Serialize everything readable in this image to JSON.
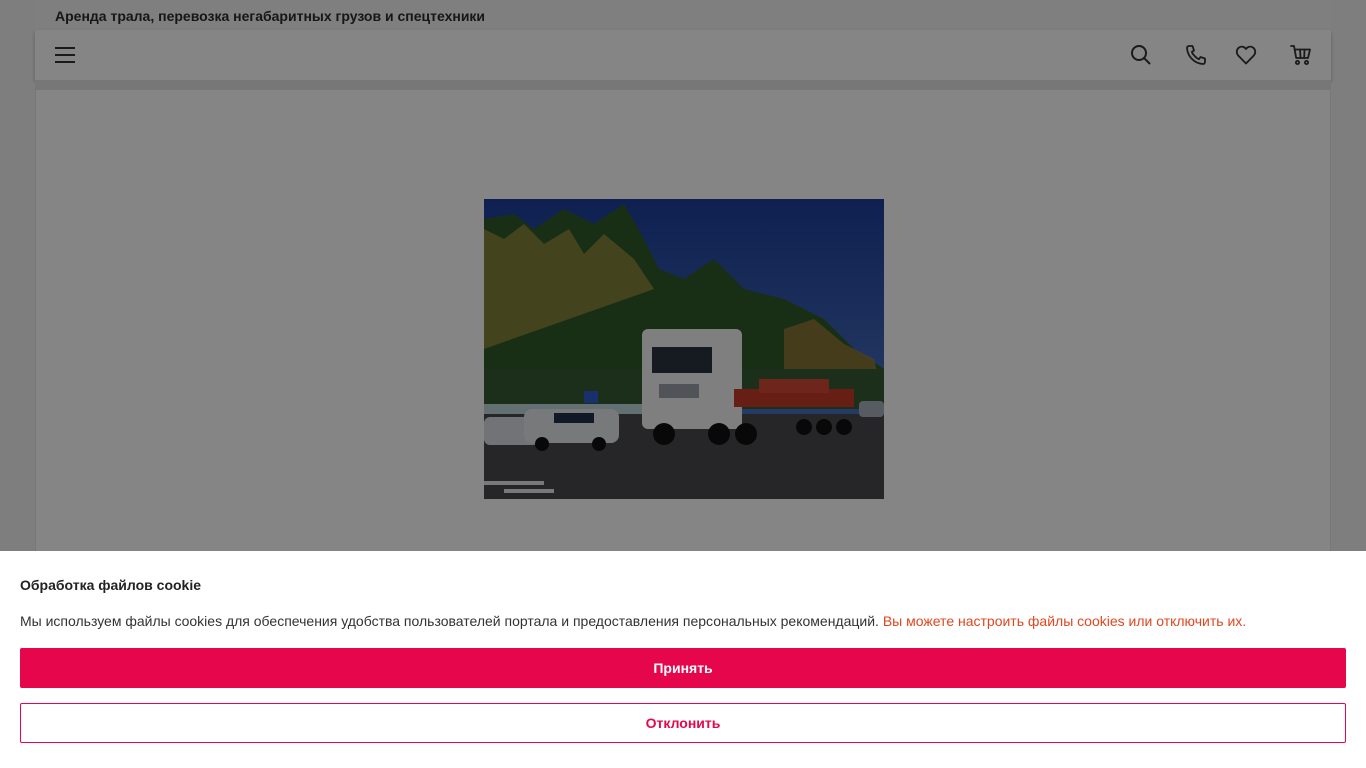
{
  "header": {
    "site_title": "Аренда трала, перевозка негабаритных грузов и спецтехники"
  },
  "nav": {
    "icons": [
      "menu-icon",
      "search-icon",
      "phone-icon",
      "heart-icon",
      "cart-icon"
    ]
  },
  "hero": {
    "image_icon": "truck-photo"
  },
  "cookie": {
    "title": "Обработка файлов cookie",
    "text": "Мы используем файлы cookies для обеспечения удобства пользователей портала и предоставления персональных рекомендаций.",
    "link": "Вы можете настроить файлы cookies или отключить их.",
    "accept_label": "Принять",
    "reject_label": "Отклонить"
  },
  "colors": {
    "accent": "#e6064b",
    "link": "#e2461e",
    "overlay": "rgba(0,0,0,0.48)"
  }
}
